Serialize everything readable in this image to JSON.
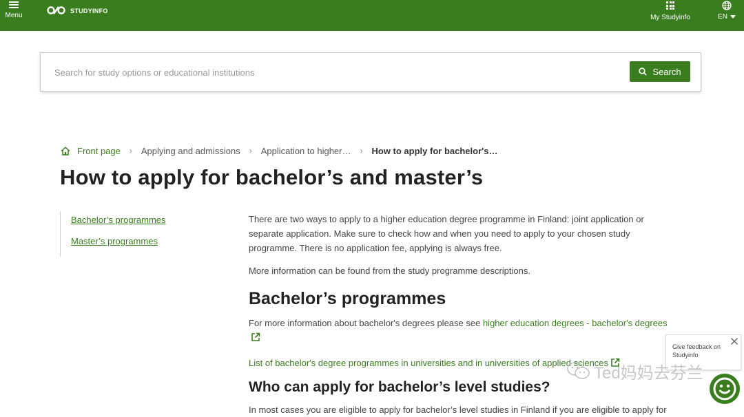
{
  "header": {
    "menu_label": "Menu",
    "logo_text": "STUDYINFO",
    "my_studyinfo_label": "My Studyinfo",
    "language_label": "EN"
  },
  "search": {
    "placeholder": "Search for study options or educational institutions",
    "value": "",
    "button_label": "Search"
  },
  "breadcrumb": {
    "items": [
      "Front page",
      "Applying and admissions",
      "Application to higher…"
    ],
    "current": "How to apply for bachelor's…"
  },
  "page": {
    "title": "How to apply for bachelor’s and master’s"
  },
  "sidenav": {
    "items": [
      "Bachelor’s programmes",
      "Master’s programmes"
    ]
  },
  "content": {
    "intro": "There are two ways to apply to a higher education degree programme in Finland: joint application or separate application. Make sure to check how and when you need to apply to your chosen study programme. There is no application fee, applying is always free.",
    "more_info": "More information can be found from the study programme descriptions.",
    "bachelor_heading": "Bachelor’s programmes",
    "bachelor_info_prefix": "For more information about bachelor's degrees please see ",
    "bachelor_info_link": "higher education degrees - bachelor's degrees",
    "bachelor_list_link": "List of bachelor's degree programmes in universities and in universities of applied sciences",
    "who_heading": "Who can apply for bachelor’s level studies?",
    "who_text": "In most cases you are eligible to apply for bachelor’s level studies in Finland if you are eligible to apply for"
  },
  "feedback": {
    "text": "Give feedback on Studyinfo"
  },
  "watermark": {
    "text": "Ted妈妈去芬兰"
  },
  "colors": {
    "brand_green": "#3a7d1f",
    "text_dark": "#222222",
    "text_body": "#444444"
  }
}
